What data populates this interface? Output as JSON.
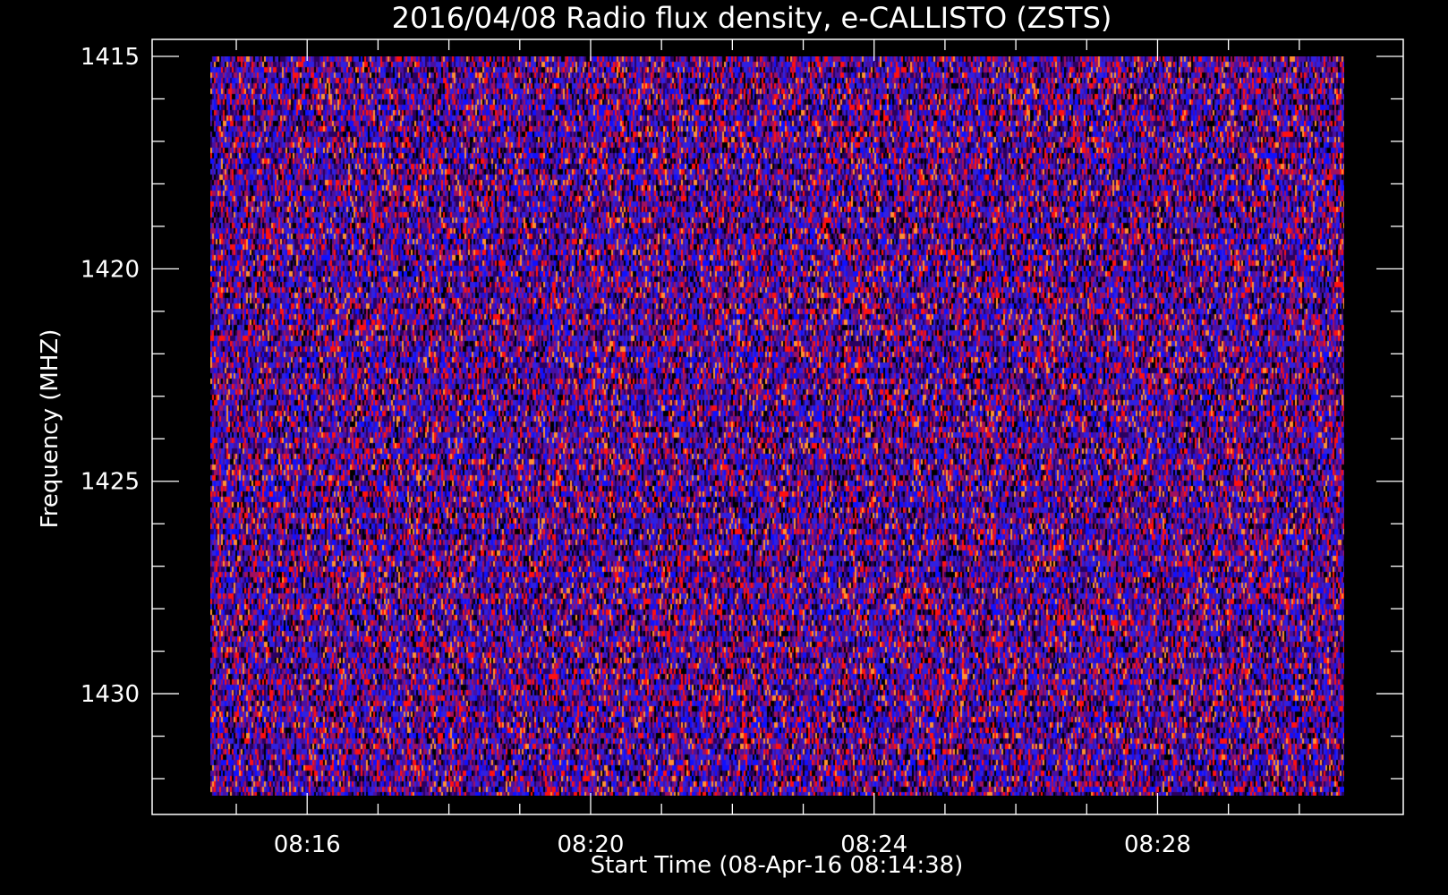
{
  "chart_data": {
    "type": "heatmap",
    "title": "2016/04/08  Radio flux density, e-CALLISTO (ZSTS)",
    "xlabel": "Start Time (08-Apr-16 08:14:38)",
    "ylabel": "Frequency (MHZ)",
    "x_start": "08:14:38",
    "x_range": [
      "08:14:38",
      "08:30:38"
    ],
    "x_ticks": [
      "08:16",
      "08:20",
      "08:24",
      "08:28"
    ],
    "y_range": [
      1415,
      1432.4
    ],
    "y_ticks": [
      "1415",
      "1420",
      "1425",
      "1430"
    ],
    "y_inverted": true,
    "grid": false,
    "colormap": [
      "#000000",
      "#2a0060",
      "#4a10a0",
      "#1010ff",
      "#3020e0",
      "#a01060",
      "#ff1010",
      "#ff9030"
    ],
    "description": "Dynamic spectrum of radio flux density as a noisy time-frequency heatmap; no distinct burst visible"
  },
  "colors": {
    "background": "#000000",
    "axis": "#ffffff",
    "text": "#ffffff"
  }
}
